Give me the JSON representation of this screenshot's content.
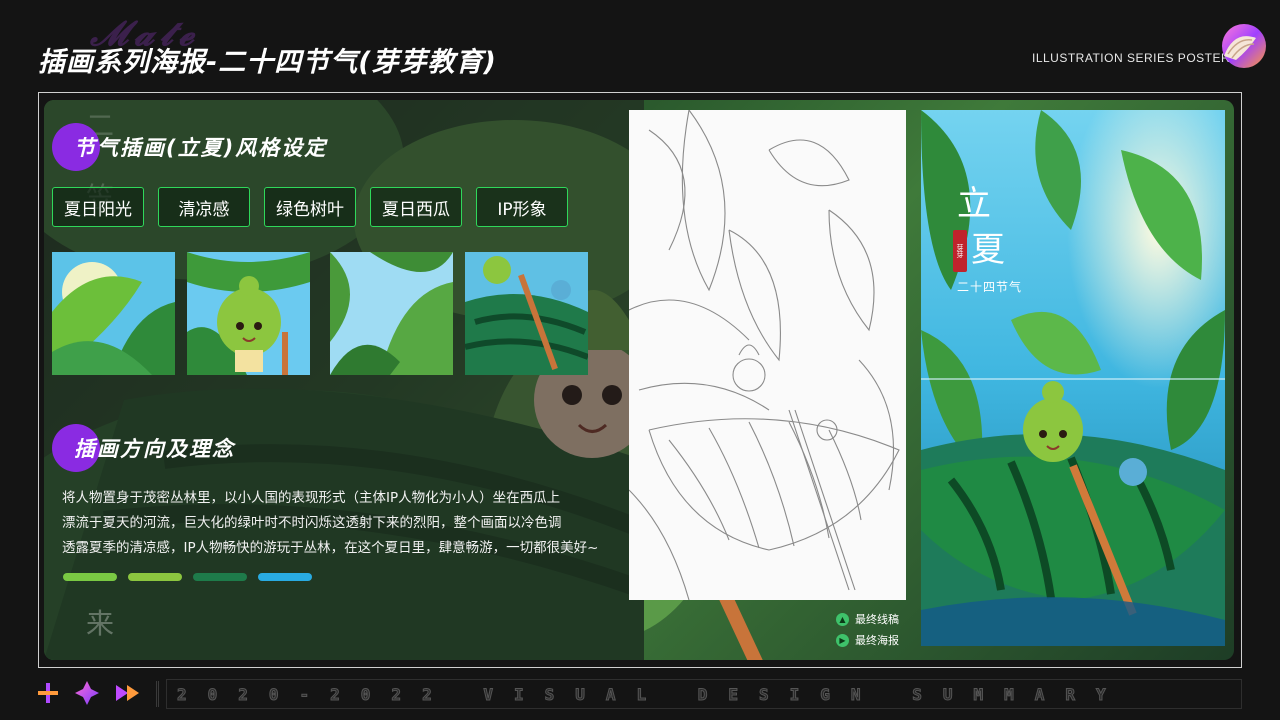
{
  "header": {
    "title": "插画系列海报-二十四节气(芽芽教育)",
    "subtitle_en": "ILLUSTRATION SERIES POSTER"
  },
  "side_text": {
    "top_char": "二",
    "second_char": "笠",
    "bottom_char": "来"
  },
  "section_style": {
    "heading": "节气插画(立夏)风格设定",
    "tags": [
      "夏日阳光",
      "清凉感",
      "绿色树叶",
      "夏日西瓜",
      "IP形象"
    ]
  },
  "thumbnails": [
    "sun-leaves-thumbnail",
    "ip-character-thumbnail",
    "leaves-sky-thumbnail",
    "watermelon-boat-thumbnail"
  ],
  "section_concept": {
    "heading": "插画方向及理念",
    "lines": [
      "将人物置身于茂密丛林里，以小人国的表现形式（主体IP人物化为小人）坐在西瓜上",
      "漂流于夏天的河流，巨大化的绿叶时不时闪烁这透射下来的烈阳，整个画面以冷色调",
      "透露夏季的清凉感，IP人物畅快的游玩于丛林，在这个夏日里，肆意畅游，一切都很美好~"
    ]
  },
  "palette": {
    "colors": [
      "#7ac943",
      "#8cc63f",
      "#1e7b4a",
      "#29abe2"
    ],
    "accent": "#8a2be2",
    "tag_border": "#2fd85a"
  },
  "poster": {
    "title_char_1": "立",
    "title_char_2": "夏",
    "series_label": "二十四节气",
    "seal_text": "芽芽"
  },
  "legend": {
    "sketch_label": "最终线稿",
    "poster_label": "最终海报"
  },
  "footer": {
    "icons": [
      "plus-icon",
      "diamond-star-icon",
      "fast-forward-icon"
    ],
    "text": "2020-2022 VISUAL DESIGN SUMMARY"
  }
}
